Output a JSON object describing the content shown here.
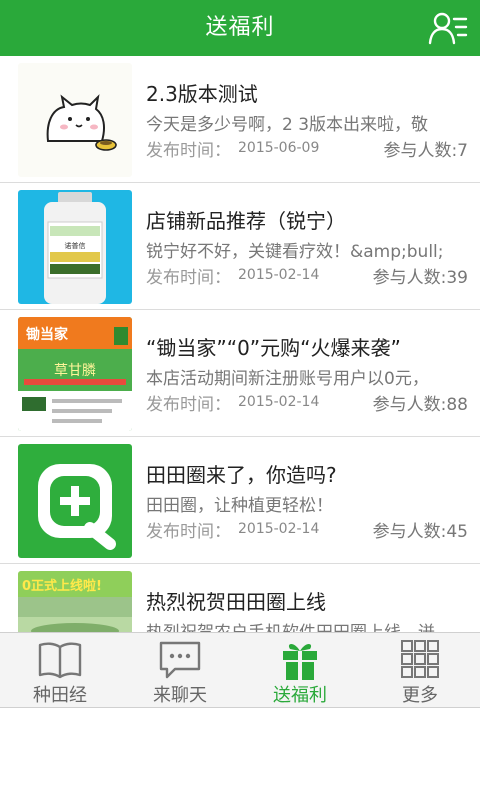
{
  "header": {
    "title": "送福利"
  },
  "posts": [
    {
      "title": "2.3版本测试",
      "desc": "今天是多少号啊，2 3版本出来啦，敬",
      "time_label": "发布时间：",
      "date": "2015-06-09",
      "count_label": "参与人数:7"
    },
    {
      "title": "店铺新品推荐（锐宁）",
      "desc": "锐宁好不好，关键看疗效！&amp;bull;",
      "time_label": "发布时间：",
      "date": "2015-02-14",
      "count_label": "参与人数:39"
    },
    {
      "title": "“锄当家”“0”元购“火爆来袭”",
      "desc": "本店活动期间新注册账号用户以0元，",
      "time_label": "发布时间：",
      "date": "2015-02-14",
      "count_label": "参与人数:88"
    },
    {
      "title": "田田圈来了，你造吗?",
      "desc": "田田圈，让种植更轻松！",
      "time_label": "发布时间：",
      "date": "2015-02-14",
      "count_label": "参与人数:45"
    },
    {
      "title": "热烈祝贺田田圈上线",
      "desc": "热烈祝贺农户手机软件田田圈上线，迸",
      "time_label": "",
      "date": "",
      "count_label": ""
    }
  ],
  "thumbs": {
    "t2_brand": "诺普信",
    "t3_brand": "锄当家",
    "t3_product": "草甘膦",
    "t5_banner": "0正式上线啦!"
  },
  "tabs": [
    {
      "label": "种田经",
      "icon": "book-icon"
    },
    {
      "label": "来聊天",
      "icon": "chat-icon"
    },
    {
      "label": "送福利",
      "icon": "gift-icon",
      "active": true
    },
    {
      "label": "更多",
      "icon": "grid-icon"
    }
  ],
  "colors": {
    "brand_green": "#2aa93a",
    "background": "#ffffff",
    "tabbar": "#f4f4f4"
  }
}
